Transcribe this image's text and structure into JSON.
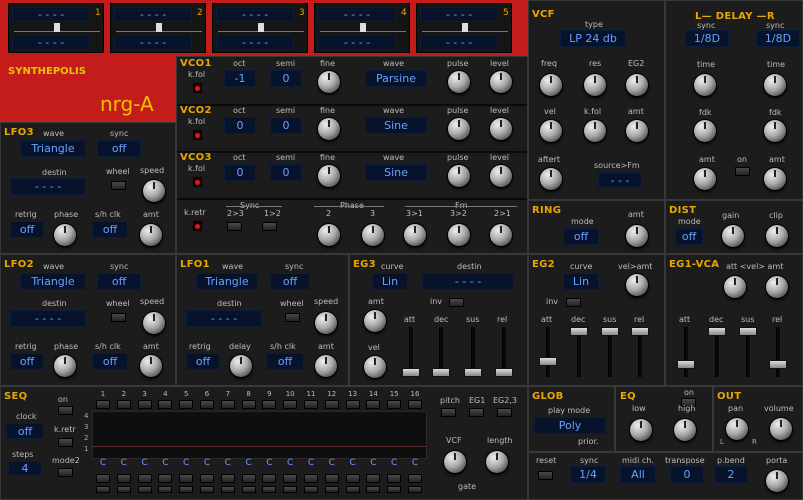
{
  "app": {
    "brand": "SYNTHEPOLIS",
    "patch": "nrg-A"
  },
  "presets": {
    "slots": [
      {
        "num": "1",
        "top": "- - - -",
        "bottom": "- - - -"
      },
      {
        "num": "2",
        "top": "- - - -",
        "bottom": "- - - -"
      },
      {
        "num": "3",
        "top": "- - - -",
        "bottom": "- - - -"
      },
      {
        "num": "4",
        "top": "- - - -",
        "bottom": "- - - -"
      },
      {
        "num": "5",
        "top": "- - - -",
        "bottom": "- - - -"
      }
    ]
  },
  "common": {
    "oct": "oct",
    "semi": "semi",
    "fine": "fine",
    "wave": "wave",
    "pulse": "pulse",
    "level": "level",
    "kfol": "k.fol",
    "sync": "sync",
    "destin": "destin",
    "wheel": "wheel",
    "speed": "speed",
    "retrig": "retrig",
    "phase": "phase",
    "shclk": "s/h clk",
    "amt": "amt",
    "delay": "delay",
    "mode": "mode",
    "att": "att",
    "dec": "dec",
    "sus": "sus",
    "rel": "rel",
    "time": "time",
    "fdk": "fdk",
    "on": "on",
    "inv": "inv",
    "curve": "curve",
    "gain": "gain",
    "clip": "clip",
    "dash": "- - - -",
    "dash3": "- - -"
  },
  "vco1": {
    "title": "VCO1",
    "oct": "-1",
    "semi": "0",
    "wave": "Parsine"
  },
  "vco2": {
    "title": "VCO2",
    "oct": "0",
    "semi": "0",
    "wave": "Sine"
  },
  "vco3": {
    "title": "VCO3",
    "oct": "0",
    "semi": "0",
    "wave": "Sine"
  },
  "vcosync": {
    "kretr": "k.retr",
    "sync": "Sync",
    "phase": "Phase",
    "fm": "Fm",
    "s23": "2>3",
    "s12": "1>2",
    "p2": "2",
    "p3": "3",
    "f31": "3>1",
    "f32": "3>2",
    "f21": "2>1"
  },
  "vcf": {
    "title": "VCF",
    "type_label": "type",
    "type": "LP 24 db",
    "freq": "freq",
    "res": "res",
    "eg2": "EG2",
    "vel": "vel",
    "kfol": "k.fol",
    "amt": "amt",
    "aftert": "aftert",
    "source_fm": "source>Fm",
    "source_val": "- - -"
  },
  "delay": {
    "title": "L— DELAY —R",
    "sync_l": "1/8D",
    "sync_r": "1/8D"
  },
  "ring": {
    "title": "RING",
    "mode": "off"
  },
  "dist": {
    "title": "DIST",
    "mode": "off"
  },
  "lfo3": {
    "title": "LFO3",
    "wave": "Triangle",
    "sync": "off",
    "retrig": "off",
    "shclk": "off"
  },
  "lfo2": {
    "title": "LFO2",
    "wave": "Triangle",
    "sync": "off",
    "retrig": "off",
    "shclk": "off"
  },
  "lfo1": {
    "title": "LFO1",
    "wave": "Triangle",
    "sync": "off",
    "retrig": "off",
    "shclk": "off"
  },
  "eg3": {
    "title": "EG3",
    "curve": "Lin",
    "vel": "vel"
  },
  "eg2": {
    "title": "EG2",
    "curve": "Lin",
    "velamt": "vel>amt"
  },
  "eg1": {
    "title": "EG1-VCA",
    "velatt": "att <vel> amt"
  },
  "seq": {
    "title": "SEQ",
    "clock": "clock",
    "clock_val": "off",
    "steps": "steps",
    "steps_val": "4",
    "kretr": "k.retr",
    "mode2": "mode2",
    "step_numbers": [
      "1",
      "2",
      "3",
      "4",
      "5",
      "6",
      "7",
      "8",
      "9",
      "10",
      "11",
      "12",
      "13",
      "14",
      "15",
      "16"
    ],
    "notes": [
      "C",
      "C",
      "C",
      "C",
      "C",
      "C",
      "C",
      "C",
      "C",
      "C",
      "C",
      "C",
      "C",
      "C",
      "C",
      "C"
    ],
    "rows": [
      "4",
      "3",
      "2",
      "1"
    ],
    "pitch": "pitch",
    "eg1": "EG1",
    "eg23": "EG2,3",
    "vcf": "VCF",
    "length": "length",
    "gate": "gate"
  },
  "glob": {
    "title": "GLOB",
    "play_mode": "play mode",
    "mode": "Poly",
    "prior": "prior.",
    "reset": "reset",
    "sync": "sync",
    "sync_val": "1/4",
    "midi": "midi ch.",
    "midi_val": "All",
    "transpose": "transpose",
    "transpose_val": "0",
    "pbend": "p.bend",
    "pbend_val": "2",
    "porta": "porta"
  },
  "eq": {
    "title": "EQ",
    "on": "on",
    "low": "low",
    "high": "high"
  },
  "out": {
    "title": "OUT",
    "pan": "pan",
    "volume": "volume",
    "l": "L",
    "r": "R"
  },
  "colors": {
    "accent": "#e8a600",
    "red": "#c81e1e",
    "lcd_text": "#6aa0ff"
  }
}
